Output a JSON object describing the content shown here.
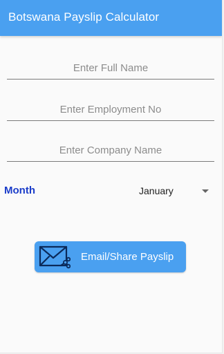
{
  "appbar": {
    "title": "Botswana Payslip Calculator"
  },
  "form": {
    "full_name_placeholder": "Enter Full Name",
    "employment_no_placeholder": "Enter Employment No",
    "company_name_placeholder": "Enter Company Name"
  },
  "month": {
    "label": "Month",
    "selected": "January"
  },
  "share_button": {
    "label": "Email/Share Payslip",
    "icon": "email-share-icon"
  },
  "colors": {
    "primary": "#4aa0f0",
    "month_label": "#1a3cc9",
    "icon_stroke": "#0b2a5a",
    "background": "#fafafa"
  }
}
